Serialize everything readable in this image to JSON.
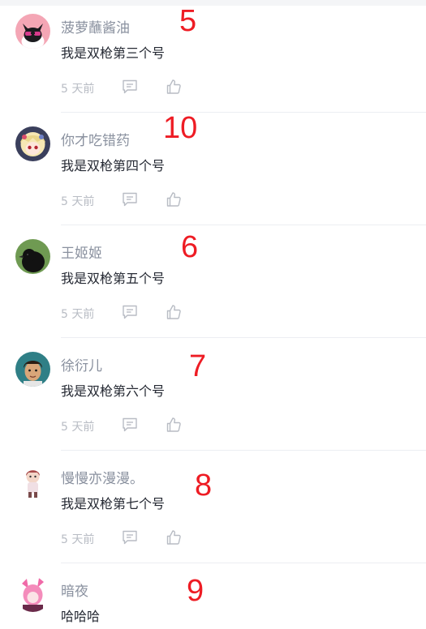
{
  "comments": [
    {
      "username": "菠萝蘸酱油",
      "content": "我是双枪第三个号",
      "time": "5 天前",
      "annotation": "5",
      "avatar_icon": "black-cat-sunglasses-avatar"
    },
    {
      "username": "你才吃错药",
      "content": "我是双枪第四个号",
      "time": "5 天前",
      "annotation": "10",
      "avatar_icon": "anime-girl-avatar"
    },
    {
      "username": "王姬姬",
      "content": "我是双枪第五个号",
      "time": "5 天前",
      "annotation": "6",
      "avatar_icon": "black-bird-green-background-avatar"
    },
    {
      "username": "徐衍儿",
      "content": "我是双枪第六个号",
      "time": "5 天前",
      "annotation": "7",
      "avatar_icon": "cartoon-boy-avatar"
    },
    {
      "username": "慢慢亦漫漫。",
      "content": "我是双枪第七个号",
      "time": "5 天前",
      "annotation": "8",
      "avatar_icon": "chibi-character-avatar"
    },
    {
      "username": "暗夜",
      "content": "哈哈哈",
      "time": "",
      "annotation": "9",
      "avatar_icon": "pink-hair-anime-avatar"
    }
  ],
  "colors": {
    "username": "#8a919f",
    "content": "#252933",
    "meta": "#b8bcc4",
    "annotation": "#ee1c24",
    "divider": "#eceef2"
  }
}
